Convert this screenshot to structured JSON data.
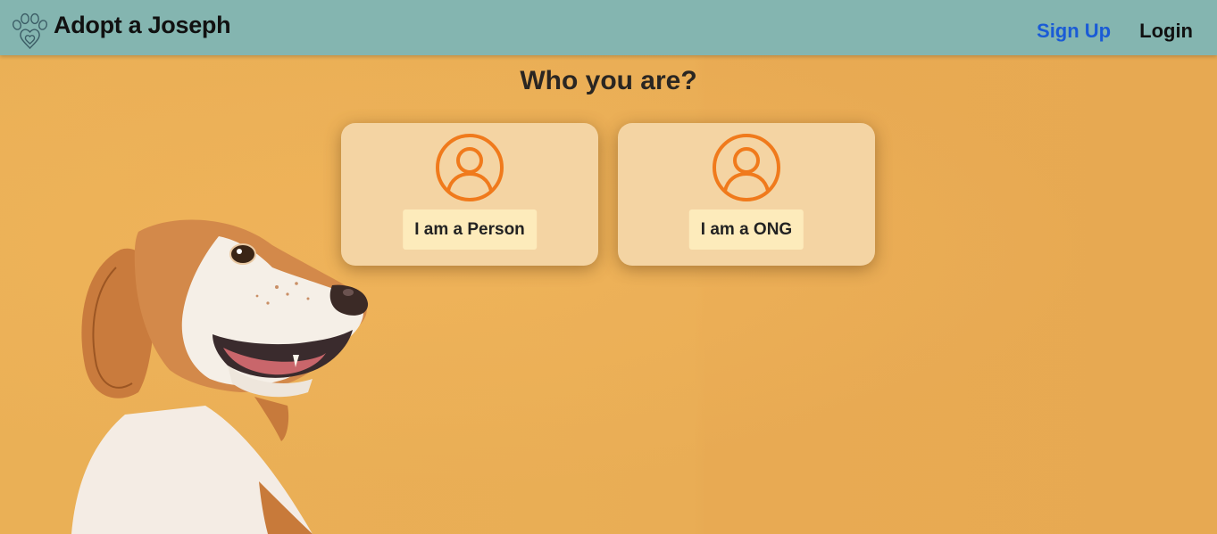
{
  "navbar": {
    "brand_name": "Adopt a Joseph",
    "brand_icon": "paw-heart-icon",
    "links": {
      "signup": "Sign Up",
      "login": "Login"
    }
  },
  "main": {
    "title": "Who you are?",
    "options": [
      {
        "label": "I am a Person",
        "icon": "user-circle-icon"
      },
      {
        "label": "I am a ONG",
        "icon": "user-circle-icon"
      }
    ]
  },
  "colors": {
    "navbar_bg": "#84b5b0",
    "page_bg": "#e8ab52",
    "card_bg": "#f4d4a3",
    "button_bg": "#fdebbb",
    "icon_accent": "#f07a1c",
    "signup_link": "#1a5bd6"
  }
}
